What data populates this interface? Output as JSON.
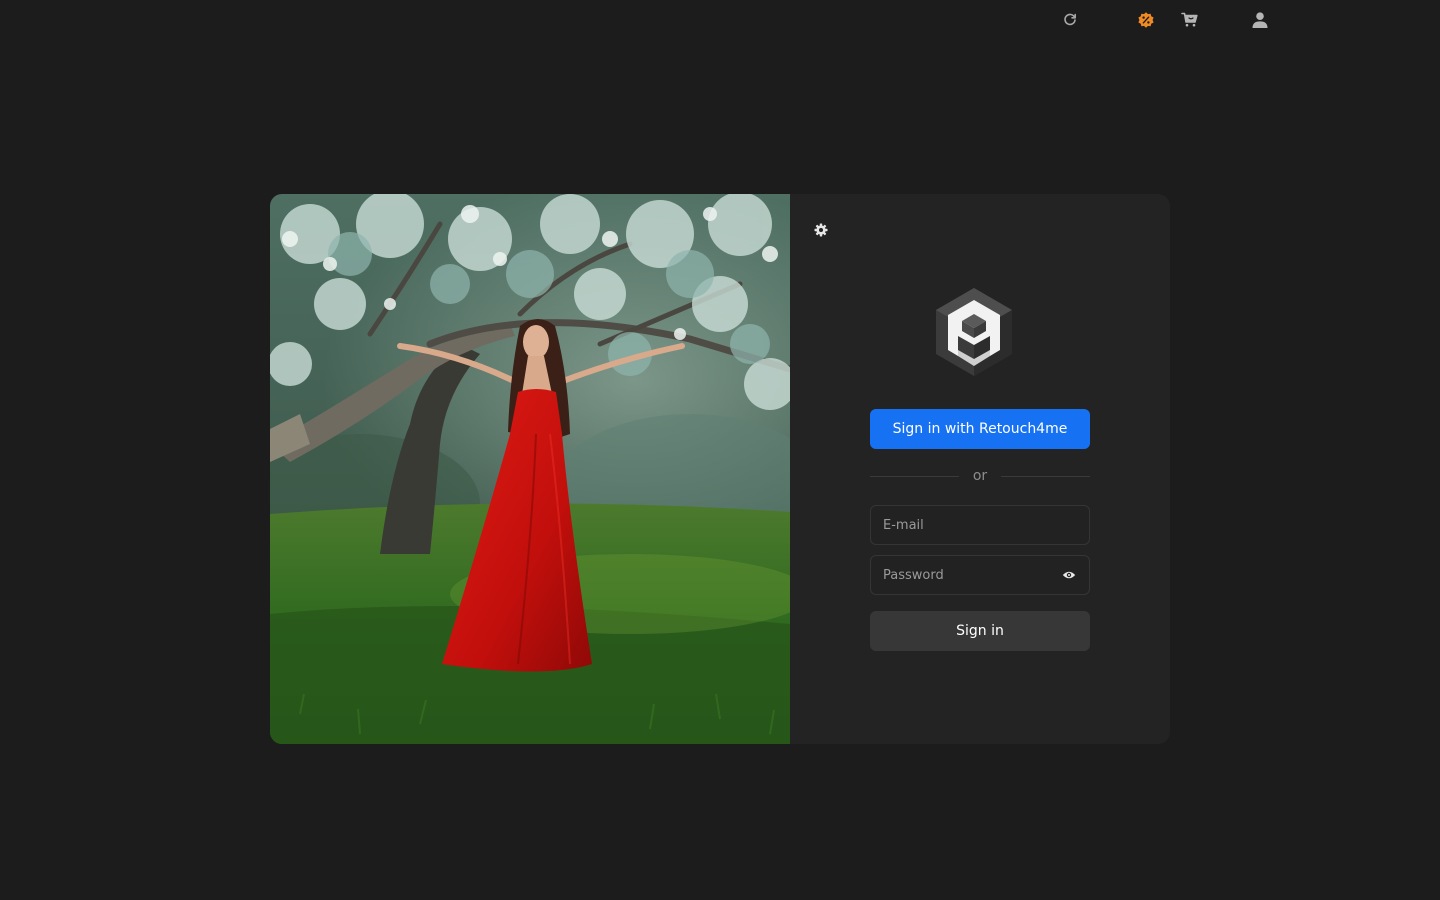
{
  "topbar": {
    "icons": [
      "refresh-icon",
      "discount-badge-icon",
      "cart-icon",
      "user-icon"
    ],
    "accent_color": "#f08a24"
  },
  "login": {
    "settings_icon": "gear-icon",
    "logo": "retouch4me-logo",
    "sso_label": "Sign in with Retouch4me",
    "or_label": "or",
    "email": {
      "placeholder": "E-mail",
      "value": ""
    },
    "password": {
      "placeholder": "Password",
      "value": "",
      "toggle_icon": "eye-icon"
    },
    "submit_label": "Sign in"
  },
  "colors": {
    "background": "#1c1c1c",
    "panel": "#232323",
    "primary": "#1672f3",
    "secondary_button": "#373737"
  }
}
